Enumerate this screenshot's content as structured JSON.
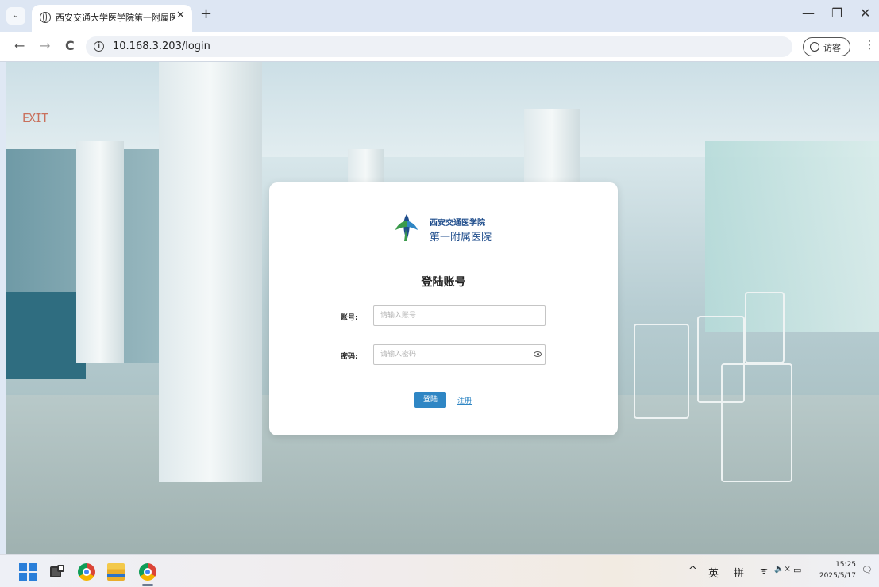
{
  "browser": {
    "tab_title": "西安交通大学医学院第一附属医",
    "tab_close": "✕",
    "new_tab": "+",
    "tab_menu_glyph": "⌄",
    "win_min": "—",
    "win_restore": "❐",
    "win_close": "✕",
    "back": "←",
    "forward": "→",
    "reload": "C",
    "url": "10.168.3.203/login",
    "profile_label": "访客",
    "menu_glyph": "⋮"
  },
  "scene": {
    "exit_sign": "EXIT"
  },
  "login": {
    "brand_line1": "西安交通医学院",
    "brand_line2": "第一附属医院",
    "heading": "登陆账号",
    "account_label": "账号:",
    "account_placeholder": "请输入账号",
    "account_value": "",
    "password_label": "密码:",
    "password_placeholder": "请输入密码",
    "password_value": "",
    "login_button": "登陆",
    "register_link": "注册",
    "logo_colors": {
      "green": "#3a9a4b",
      "blue": "#1f4d8c",
      "teal": "#2f86c4"
    }
  },
  "taskbar": {
    "tray_caret": "^",
    "ime_lang": "英",
    "ime_mode": "拼",
    "wifi": "ᯤ",
    "volume": "🔈×",
    "battery": "▭",
    "time": "15:25",
    "date": "2025/5/17",
    "notification": "🗨",
    "icons": [
      "windows-start-icon",
      "task-view-icon",
      "chrome-icon",
      "file-explorer-icon",
      "chrome-active-icon"
    ]
  }
}
